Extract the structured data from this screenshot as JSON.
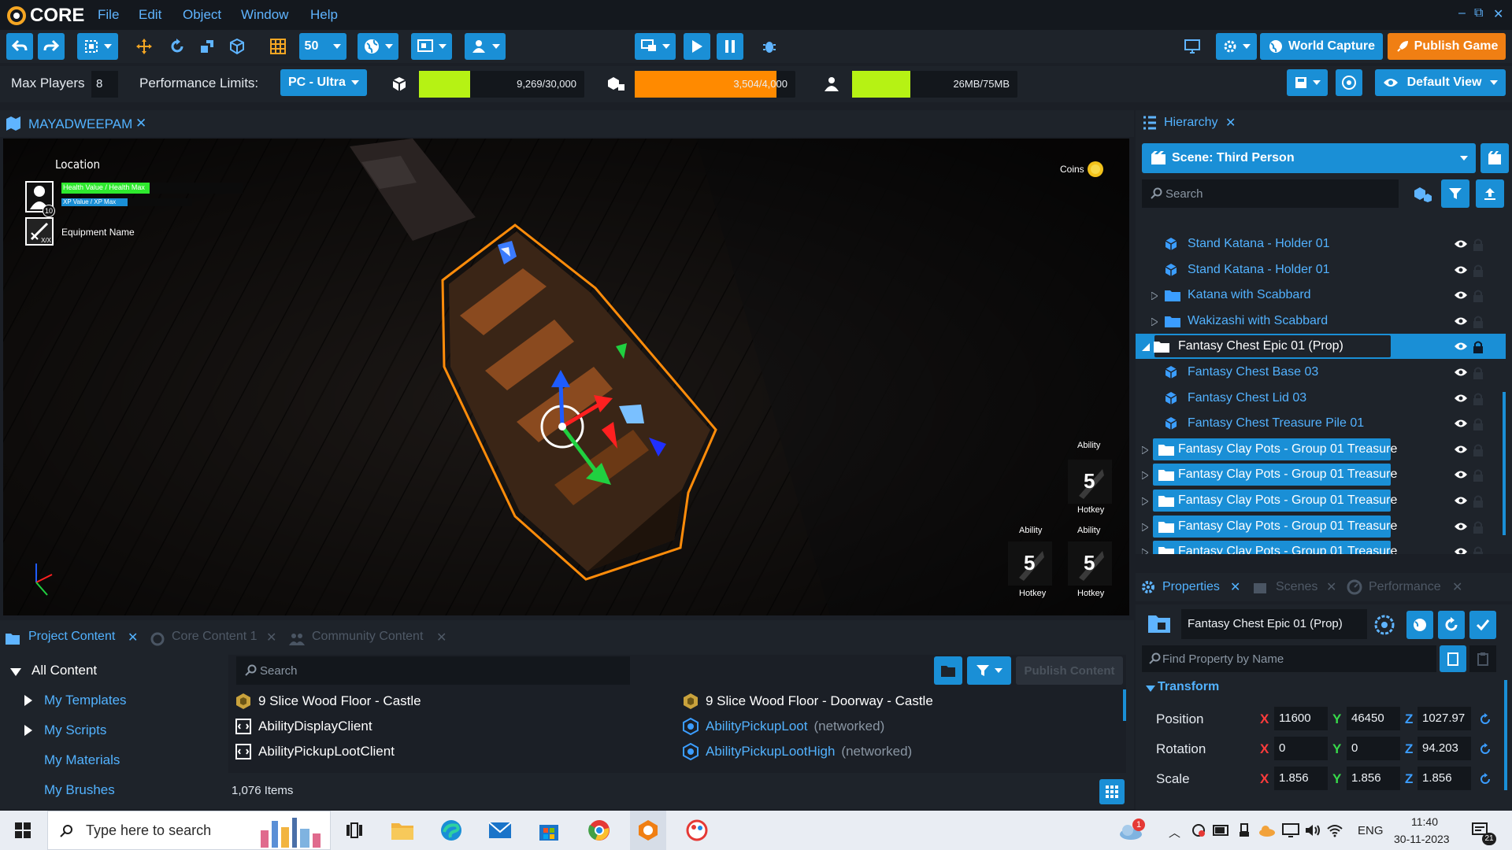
{
  "app": {
    "logo_text": "CORE",
    "menu": [
      "File",
      "Edit",
      "Object",
      "Window",
      "Help"
    ],
    "window_controls": [
      "–",
      "⧉",
      "✕"
    ]
  },
  "toolbar": {
    "grid_value": "50",
    "world_capture_label": "World Capture",
    "publish_game_label": "Publish Game",
    "default_view_label": "Default View"
  },
  "perf": {
    "max_players_label": "Max Players",
    "max_players_value": "8",
    "limits_label": "Performance Limits:",
    "limits_value": "PC - Ultra",
    "meter1_text": "9,269/30,000",
    "meter1_fraction": 0.31,
    "meter1_color": "#b6f214",
    "meter2_text": "3,504/4,000",
    "meter2_fraction": 0.88,
    "meter2_color": "#ff8a00",
    "meter3_text": "26MB/75MB",
    "meter3_fraction": 0.35,
    "meter3_color": "#b6f214"
  },
  "viewport": {
    "tab_label": "MAYADWEEPAM",
    "location_label": "Location",
    "health_label": "Health Value / Health Max",
    "xp_label": "XP Value / XP Max",
    "level_value": "10",
    "equipment_label": "Equipment Name",
    "equipment_counter": "X/X",
    "coins_label": "Coins",
    "ability_label": "Ability",
    "hotkey_label": "Hotkey",
    "ability_value": "5"
  },
  "content": {
    "tabs": [
      "Project Content",
      "Core Content 1",
      "Community Content"
    ],
    "tree": [
      "All Content",
      "My Templates",
      "My Scripts",
      "My Materials",
      "My Brushes"
    ],
    "search_placeholder": "Search",
    "publish_content_label": "Publish Content",
    "items_count": "1,076 Items",
    "items": [
      {
        "name": "9 Slice Wood Floor - Castle",
        "suffix": "",
        "icon": "template-icon"
      },
      {
        "name": "AbilityDisplayClient",
        "suffix": "",
        "icon": "script-icon"
      },
      {
        "name": "AbilityPickupLootClient",
        "suffix": "",
        "icon": "script-icon"
      },
      {
        "name": "9 Slice Wood Floor - Doorway - Castle",
        "suffix": "",
        "icon": "template-icon"
      },
      {
        "name": "AbilityPickupLoot",
        "suffix": "(networked)",
        "icon": "networked-template-icon"
      },
      {
        "name": "AbilityPickupLootHigh",
        "suffix": "(networked)",
        "icon": "networked-template-icon"
      }
    ]
  },
  "hierarchy": {
    "tab_label": "Hierarchy",
    "scene_label": "Scene: Third Person",
    "search_placeholder": "Search",
    "rows": [
      {
        "label": "Stand Katana - Holder 01",
        "type": "object",
        "indent": 2
      },
      {
        "label": "Stand Katana - Holder 01",
        "type": "object",
        "indent": 2
      },
      {
        "label": "Katana with Scabbard",
        "type": "group",
        "indent": 1
      },
      {
        "label": "Wakizashi with Scabbard",
        "type": "group",
        "indent": 1
      },
      {
        "label": "Fantasy Chest Epic 01 (Prop)",
        "type": "selected",
        "indent": 0
      },
      {
        "label": "Fantasy Chest Base 03",
        "type": "object",
        "indent": 2
      },
      {
        "label": "Fantasy Chest Lid 03",
        "type": "object",
        "indent": 2
      },
      {
        "label": "Fantasy Chest Treasure Pile 01",
        "type": "object",
        "indent": 2
      },
      {
        "label": "Fantasy Clay Pots - Group 01 Treasure",
        "type": "template",
        "indent": 0
      },
      {
        "label": "Fantasy Clay Pots - Group 01 Treasure",
        "type": "template",
        "indent": 0
      },
      {
        "label": "Fantasy Clay Pots - Group 01 Treasure",
        "type": "template",
        "indent": 0
      },
      {
        "label": "Fantasy Clay Pots - Group 01 Treasure",
        "type": "template",
        "indent": 0
      },
      {
        "label": "Fantasy Clay Pots - Group 01 Treasure",
        "type": "template",
        "indent": 0
      }
    ]
  },
  "properties": {
    "tabs": [
      "Properties",
      "Scenes",
      "Performance"
    ],
    "object_name": "Fantasy Chest Epic 01 (Prop)",
    "find_placeholder": "Find Property by Name",
    "transform_label": "Transform",
    "position_label": "Position",
    "rotation_label": "Rotation",
    "scale_label": "Scale",
    "axis_x": "X",
    "axis_y": "Y",
    "axis_z": "Z",
    "position": {
      "x": "11600",
      "y": "46450",
      "z": "1027.97"
    },
    "rotation": {
      "x": "0",
      "y": "0",
      "z": "94.203"
    },
    "scale": {
      "x": "1.856",
      "y": "1.856",
      "z": "1.856"
    },
    "colors": {
      "x": "#ff3b3b",
      "y": "#37d94a",
      "z": "#3b9dff"
    }
  },
  "taskbar": {
    "search_placeholder": "Type here to search",
    "notification_count": "1",
    "language": "ENG",
    "time": "11:40",
    "date": "30-11-2023",
    "action_center_count": "21"
  }
}
